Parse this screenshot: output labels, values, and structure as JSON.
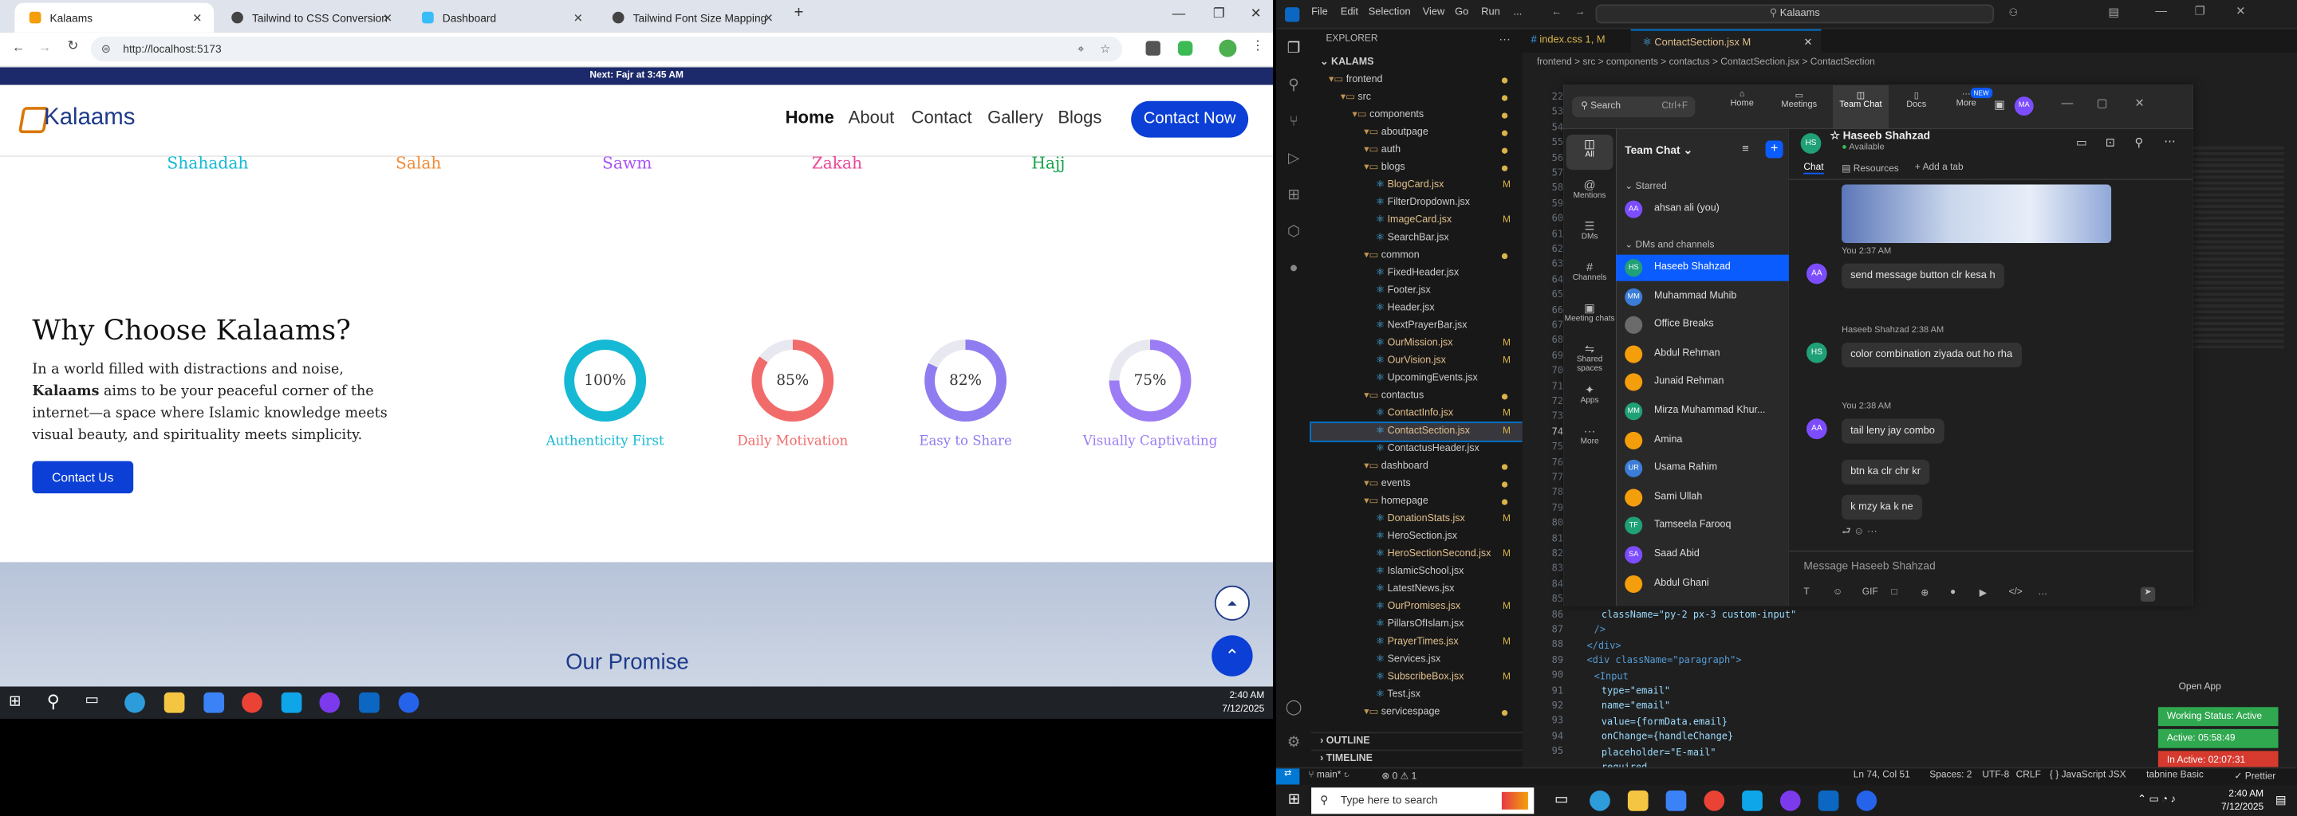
{
  "browser": {
    "tabs": [
      "Kalaams",
      "Tailwind to CSS Conversion",
      "Dashboard",
      "Tailwind Font Size Mapping"
    ],
    "url": "http://localhost:5173"
  },
  "site": {
    "ticker": "Next: Fajr at 3:45 AM",
    "logo": "Kalaams",
    "nav": [
      "Home",
      "About",
      "Contact",
      "Gallery",
      "Blogs"
    ],
    "contact_button": "Contact Now",
    "pillars": [
      "Shahadah",
      "Salah",
      "Sawm",
      "Zakah",
      "Hajj"
    ],
    "heading": "Why Choose Kalaams?",
    "para_1": "In a world filled with distractions and noise,",
    "para_brand": "Kalaams",
    "para_2": " aims to be your peaceful corner of the",
    "para_3": "internet—a space where Islamic knowledge meets",
    "para_4": "visual beauty, and spirituality meets simplicity.",
    "contact_us": "Contact Us",
    "stats": [
      {
        "value": "100%",
        "label": "Authenticity First",
        "color": "#16b9d4",
        "pct": 100
      },
      {
        "value": "85%",
        "label": "Daily Motivation",
        "color": "#f26b6b",
        "pct": 85
      },
      {
        "value": "82%",
        "label": "Easy to Share",
        "color": "#8e7cf0",
        "pct": 82
      },
      {
        "value": "75%",
        "label": "Visually Captivating",
        "color": "#9b7cf5",
        "pct": 75
      }
    ],
    "promise": "Our Promise"
  },
  "taskbar_left": {
    "time": "2:40 AM",
    "date": "7/12/2025"
  },
  "vscode": {
    "menu": [
      "File",
      "Edit",
      "Selection",
      "View",
      "Go",
      "Run",
      "..."
    ],
    "search": "Kalaams",
    "tabs": [
      "index.css 1, M",
      "ContactSection.jsx M"
    ],
    "breadcrumb": "frontend > src > components > contactus > ContactSection.jsx > ContactSection",
    "explorer_title": "EXPLORER",
    "root": "KALAMS",
    "tree": [
      {
        "name": "frontend",
        "d": 1,
        "f": true
      },
      {
        "name": "src",
        "d": 2,
        "f": true
      },
      {
        "name": "components",
        "d": 3,
        "f": true
      },
      {
        "name": "aboutpage",
        "d": 4,
        "f": true
      },
      {
        "name": "auth",
        "d": 4,
        "f": true
      },
      {
        "name": "blogs",
        "d": 4,
        "f": true
      },
      {
        "name": "BlogCard.jsx",
        "d": 5,
        "m": "M"
      },
      {
        "name": "FilterDropdown.jsx",
        "d": 5
      },
      {
        "name": "ImageCard.jsx",
        "d": 5,
        "m": "M"
      },
      {
        "name": "SearchBar.jsx",
        "d": 5
      },
      {
        "name": "common",
        "d": 4,
        "f": true
      },
      {
        "name": "FixedHeader.jsx",
        "d": 5
      },
      {
        "name": "Footer.jsx",
        "d": 5
      },
      {
        "name": "Header.jsx",
        "d": 5
      },
      {
        "name": "NextPrayerBar.jsx",
        "d": 5
      },
      {
        "name": "OurMission.jsx",
        "d": 5,
        "m": "M"
      },
      {
        "name": "OurVision.jsx",
        "d": 5,
        "m": "M"
      },
      {
        "name": "UpcomingEvents.jsx",
        "d": 5
      },
      {
        "name": "contactus",
        "d": 4,
        "f": true
      },
      {
        "name": "ContactInfo.jsx",
        "d": 5,
        "m": "M"
      },
      {
        "name": "ContactSection.jsx",
        "d": 5,
        "m": "M",
        "sel": true
      },
      {
        "name": "ContactusHeader.jsx",
        "d": 5
      },
      {
        "name": "dashboard",
        "d": 4,
        "f": true
      },
      {
        "name": "events",
        "d": 4,
        "f": true
      },
      {
        "name": "homepage",
        "d": 4,
        "f": true
      },
      {
        "name": "DonationStats.jsx",
        "d": 5,
        "m": "M"
      },
      {
        "name": "HeroSection.jsx",
        "d": 5
      },
      {
        "name": "HeroSectionSecond.jsx",
        "d": 5,
        "m": "M"
      },
      {
        "name": "IslamicSchool.jsx",
        "d": 5
      },
      {
        "name": "LatestNews.jsx",
        "d": 5
      },
      {
        "name": "OurPromises.jsx",
        "d": 5,
        "m": "M"
      },
      {
        "name": "PillarsOfIslam.jsx",
        "d": 5
      },
      {
        "name": "PrayerTimes.jsx",
        "d": 5,
        "m": "M"
      },
      {
        "name": "Services.jsx",
        "d": 5
      },
      {
        "name": "SubscribeBox.jsx",
        "d": 5,
        "m": "M"
      },
      {
        "name": "Test.jsx",
        "d": 5
      },
      {
        "name": "servicespage",
        "d": 4,
        "f": true
      }
    ],
    "outline": "OUTLINE",
    "timeline": "TIMELINE",
    "line_numbers": [
      "22",
      "53",
      "54",
      "55",
      "56",
      "57",
      "58",
      "59",
      "60",
      "61",
      "62",
      "63",
      "64",
      "65",
      "66",
      "67",
      "68",
      "69",
      "70",
      "71",
      "72",
      "73",
      "74",
      "75",
      "76",
      "77",
      "78",
      "79",
      "80",
      "81",
      "82",
      "83",
      "84",
      "85",
      "86",
      "87",
      "88",
      "89",
      "90",
      "91",
      "92",
      "93",
      "94",
      "95"
    ],
    "code": [
      {
        "t": "className=\"py-2 px-3 custom-input\"",
        "i": 4
      },
      {
        "t": "/>",
        "i": 3
      },
      {
        "t": "</div>",
        "i": 2
      },
      {
        "t": "<div className=\"paragraph\">",
        "i": 2
      },
      {
        "t": "<Input",
        "i": 3
      },
      {
        "t": "type=\"email\"",
        "i": 4
      },
      {
        "t": "name=\"email\"",
        "i": 4
      },
      {
        "t": "value={formData.email}",
        "i": 4
      },
      {
        "t": "onChange={handleChange}",
        "i": 4
      },
      {
        "t": "placeholder=\"E-mail\"",
        "i": 4
      },
      {
        "t": "required",
        "i": 4
      }
    ],
    "status": {
      "branch": "main*",
      "problems": "⊗ 0 ⚠ 1",
      "pos": "Ln 74, Col 51",
      "spaces": "Spaces: 2",
      "enc": "UTF-8",
      "eol": "CRLF",
      "lang": "JavaScript JSX",
      "tabnine": "tabnine Basic",
      "prettier": "Prettier"
    }
  },
  "teams": {
    "search": "Search",
    "shortcut": "Ctrl+F",
    "top_nav": [
      "Home",
      "Meetings",
      "Team Chat",
      "Docs",
      "More"
    ],
    "new_badge": "NEW",
    "avatar": "MA",
    "rail": [
      "All",
      "Mentions",
      "DMs",
      "Channels",
      "Meeting chats",
      "Shared spaces",
      "Apps",
      "More"
    ],
    "list_title": "Team Chat",
    "starred": "Starred",
    "dms": "DMs and channels",
    "self": "ahsan ali (you)",
    "contacts": [
      {
        "name": "Haseeb Shahzad",
        "init": "HS",
        "c": "#20a077",
        "sel": true
      },
      {
        "name": "Muhammad Muhib",
        "init": "MM",
        "c": "#3b7dd8"
      },
      {
        "name": "Office Breaks",
        "init": "",
        "c": "#6b6b6b"
      },
      {
        "name": "Abdul Rehman",
        "init": "",
        "c": "#f59e0b"
      },
      {
        "name": "Junaid Rehman",
        "init": "",
        "c": "#f59e0b"
      },
      {
        "name": "Mirza Muhammad Khur...",
        "init": "MM",
        "c": "#20a077"
      },
      {
        "name": "Amina",
        "init": "",
        "c": "#f59e0b"
      },
      {
        "name": "Usama Rahim",
        "init": "UR",
        "c": "#3b7dd8"
      },
      {
        "name": "Sami Ullah",
        "init": "",
        "c": "#f59e0b"
      },
      {
        "name": "Tamseela Farooq",
        "init": "TF",
        "c": "#20a077"
      },
      {
        "name": "Saad Abid",
        "init": "SA",
        "c": "#7c4dff"
      },
      {
        "name": "Abdul Ghani",
        "init": "",
        "c": "#f59e0b"
      }
    ],
    "chat_name": "Haseeb Shahzad",
    "chat_init": "HS",
    "presence": "Available",
    "chat_tabs": [
      "Chat",
      "Resources",
      "Add a tab"
    ],
    "messages": [
      {
        "meta": "You 2:37 AM",
        "text": "send message button clr kesa h",
        "who": "AA"
      },
      {
        "meta": "Haseeb Shahzad 2:38 AM",
        "text": "color combination ziyada out ho rha",
        "who": "HS"
      },
      {
        "meta": "You 2:38 AM",
        "text": "tail leny jay combo",
        "who": "AA"
      },
      {
        "meta": "",
        "text": "btn ka clr chr kr",
        "who": ""
      },
      {
        "meta": "",
        "text": "k mzy ka k ne",
        "who": ""
      }
    ],
    "composer_placeholder": "Message Haseeb Shahzad",
    "toolbar": [
      "T",
      "☺",
      "GIF",
      "□",
      "⊕",
      "●",
      "▶",
      "</>",
      "…"
    ]
  },
  "tracker": {
    "open": "Open App",
    "status": "Working Status: Active",
    "active": "Active: 05:58:49",
    "inactive": "In Active: 02:07:31"
  },
  "taskbar_right": {
    "search": "Type here to search",
    "time": "2:40 AM",
    "date": "7/12/2025"
  }
}
